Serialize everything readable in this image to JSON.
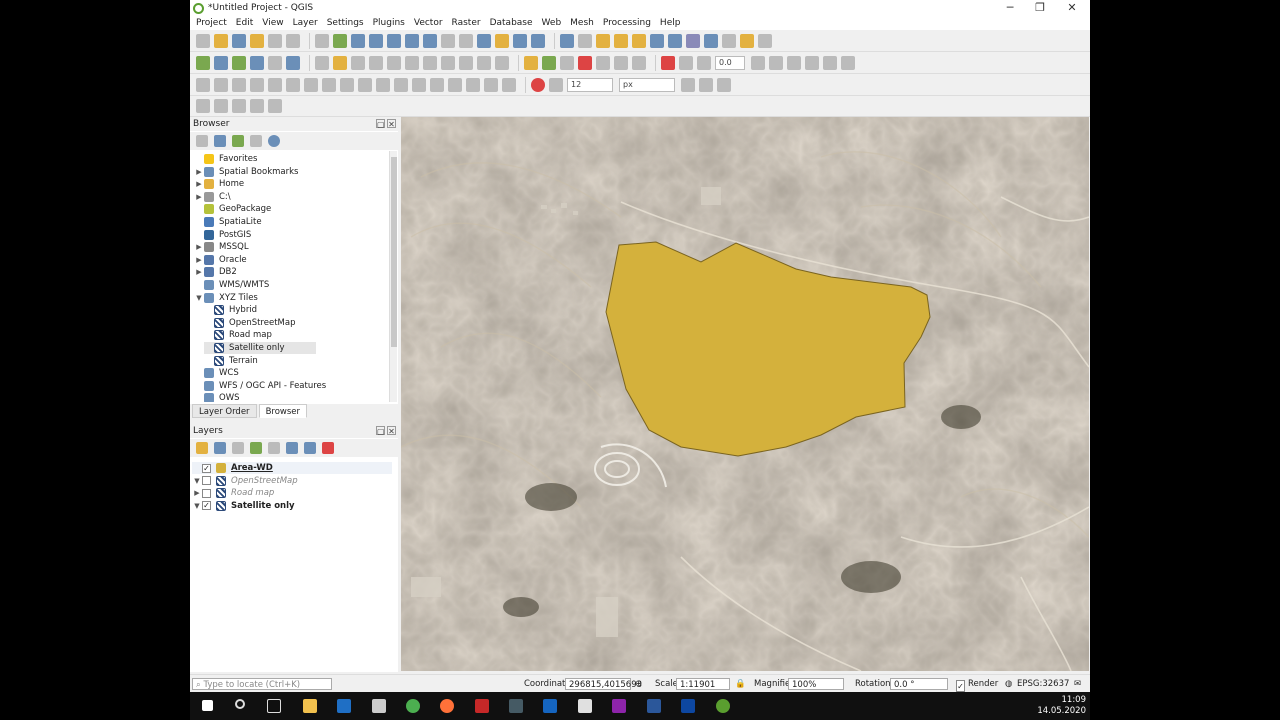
{
  "window": {
    "title": "*Untitled Project - QGIS",
    "controls": {
      "minimize": "─",
      "maximize": "❐",
      "close": "✕"
    }
  },
  "menu": [
    "Project",
    "Edit",
    "View",
    "Layer",
    "Settings",
    "Plugins",
    "Vector",
    "Raster",
    "Database",
    "Web",
    "Mesh",
    "Processing",
    "Help"
  ],
  "toolbar": {
    "rotation_value": "0.0",
    "font_size_value": "12",
    "font_unit": "px"
  },
  "browser": {
    "title": "Browser",
    "items": [
      {
        "label": "Favorites",
        "arrow": "",
        "icon": "star-icon",
        "color": "#f5c518"
      },
      {
        "label": "Spatial Bookmarks",
        "arrow": "▶",
        "icon": "bookmark-icon",
        "color": "#6b8fb8"
      },
      {
        "label": "Home",
        "arrow": "▶",
        "icon": "home-folder-icon",
        "color": "#e3b140"
      },
      {
        "label": "C:\\",
        "arrow": "▶",
        "icon": "drive-icon",
        "color": "#999999"
      },
      {
        "label": "GeoPackage",
        "arrow": "",
        "icon": "geopackage-icon",
        "color": "#b5c23a"
      },
      {
        "label": "SpatiaLite",
        "arrow": "",
        "icon": "spatialite-icon",
        "color": "#4a7ab8"
      },
      {
        "label": "PostGIS",
        "arrow": "",
        "icon": "postgis-icon",
        "color": "#336699"
      },
      {
        "label": "MSSQL",
        "arrow": "▶",
        "icon": "mssql-icon",
        "color": "#888888"
      },
      {
        "label": "Oracle",
        "arrow": "▶",
        "icon": "oracle-icon",
        "color": "#5577aa"
      },
      {
        "label": "DB2",
        "arrow": "▶",
        "icon": "db2-icon",
        "color": "#5577aa"
      },
      {
        "label": "WMS/WMTS",
        "arrow": "",
        "icon": "wms-icon",
        "color": "#6b8fb8"
      },
      {
        "label": "XYZ Tiles",
        "arrow": "▼",
        "icon": "xyz-tiles-icon",
        "color": "#6b8fb8"
      },
      {
        "label": "Hybrid",
        "arrow": "",
        "icon": "xyz-layer-icon",
        "child": true
      },
      {
        "label": "OpenStreetMap",
        "arrow": "",
        "icon": "xyz-layer-icon",
        "child": true
      },
      {
        "label": "Road map",
        "arrow": "",
        "icon": "xyz-layer-icon",
        "child": true
      },
      {
        "label": "Satellite only",
        "arrow": "",
        "icon": "xyz-layer-icon",
        "child": true,
        "selected": true
      },
      {
        "label": "Terrain",
        "arrow": "",
        "icon": "xyz-layer-icon",
        "child": true
      },
      {
        "label": "WCS",
        "arrow": "",
        "icon": "wcs-icon",
        "color": "#6b8fb8"
      },
      {
        "label": "WFS / OGC API - Features",
        "arrow": "",
        "icon": "wfs-icon",
        "color": "#6b8fb8"
      },
      {
        "label": "OWS",
        "arrow": "",
        "icon": "ows-icon",
        "color": "#6b8fb8"
      }
    ],
    "tabs": [
      "Layer Order",
      "Browser"
    ]
  },
  "layers": {
    "title": "Layers",
    "items": [
      {
        "label": "Area-WD",
        "checked": "✓",
        "arrow": "",
        "style": "bold-underline",
        "symbol_color": "#d4b13c"
      },
      {
        "label": "OpenStreetMap",
        "checked": "",
        "arrow": "▼",
        "style": "italic-gray"
      },
      {
        "label": "Road map",
        "checked": "",
        "arrow": "▶",
        "style": "italic-gray"
      },
      {
        "label": "Satellite only",
        "checked": "✓",
        "arrow": "▼",
        "style": "bold"
      }
    ]
  },
  "statusbar": {
    "locate_placeholder": "Type to locate (Ctrl+K)",
    "coordinate_label": "Coordinate",
    "coordinate_value": "296815,4015693",
    "scale_label": "Scale",
    "scale_value": "1:11901",
    "magnifier_label": "Magnifier",
    "magnifier_value": "100%",
    "rotation_label": "Rotation",
    "rotation_value": "0.0 °",
    "render_label": "Render",
    "render_checked": "✓",
    "crs": "EPSG:32637"
  },
  "taskbar": {
    "time": "11:09",
    "date": "14.05.2020"
  },
  "colors": {
    "polygon_fill": "#d4b13c",
    "polygon_stroke": "#7a6420"
  }
}
